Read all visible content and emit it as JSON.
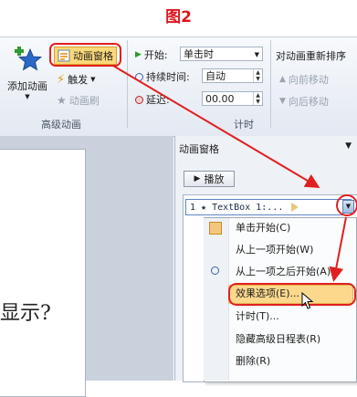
{
  "figure_title": "图2",
  "ribbon": {
    "add_animation_label": "添加动画",
    "animation_pane_label": "动画窗格",
    "trigger_label": "触发",
    "animation_painter_label": "动画刷",
    "advanced_group_label": "高级动画",
    "start_label": "开始:",
    "start_value": "单击时",
    "duration_label": "持续时间:",
    "duration_value": "自动",
    "delay_label": "延迟:",
    "delay_value": "00.00",
    "timing_group_label": "计时",
    "reorder_label": "对动画重新排序",
    "move_earlier_label": "向前移动",
    "move_later_label": "向后移动"
  },
  "slide_text": "显示?",
  "pane": {
    "title": "动画窗格",
    "play_label": "播放",
    "item_text": "1 ★ TextBox 1:..."
  },
  "menu": {
    "items": [
      "单击开始(C)",
      "从上一项开始(W)",
      "从上一项之后开始(A)",
      "效果选项(E)...",
      "计时(T)...",
      "隐藏高级日程表(R)",
      "删除(R)"
    ]
  },
  "colors": {
    "annotation_red": "#e02020",
    "ribbon_bg": "#e3e9f2"
  }
}
